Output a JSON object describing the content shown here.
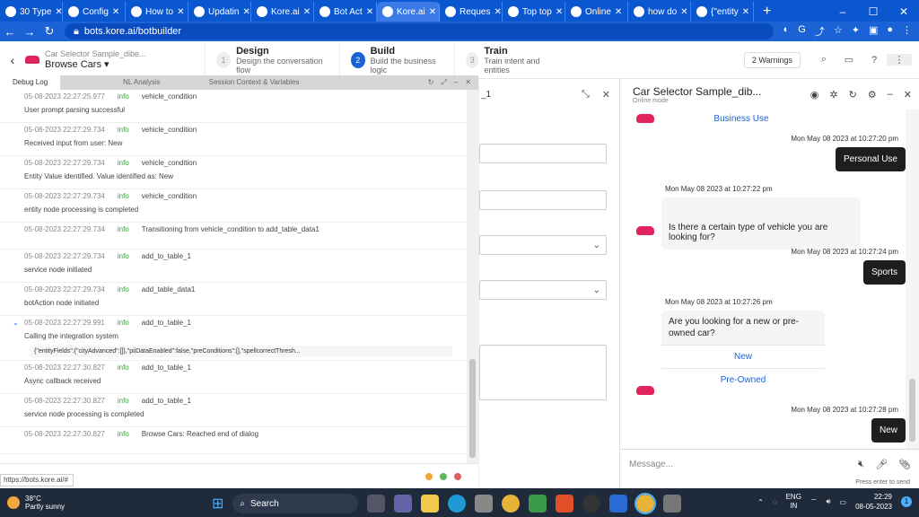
{
  "browser": {
    "tabs": [
      {
        "label": "30 Type"
      },
      {
        "label": "Config"
      },
      {
        "label": "How to"
      },
      {
        "label": "Updatin"
      },
      {
        "label": "Kore.ai"
      },
      {
        "label": "Bot Act"
      },
      {
        "label": "Kore.ai",
        "active": true
      },
      {
        "label": "Reques"
      },
      {
        "label": "Top top"
      },
      {
        "label": "Online"
      },
      {
        "label": "how do"
      },
      {
        "label": "{\"entity"
      }
    ],
    "new_tab": "+",
    "url": "bots.kore.ai/botbuilder"
  },
  "app_header": {
    "bot_subtitle": "Car Selector Sample_dibe...",
    "dialog_name": "Browse Cars",
    "steps": [
      {
        "num": "1",
        "title": "Design",
        "desc": "Design the conversation flow"
      },
      {
        "num": "2",
        "title": "Build",
        "desc": "Build the business logic",
        "active": true
      },
      {
        "num": "3",
        "title": "Train",
        "desc": "Train intent and entities"
      }
    ],
    "warnings": "2 Warnings"
  },
  "debug": {
    "tabs": [
      "Debug Log",
      "NL Analysis",
      "Session Context & Variables"
    ],
    "entries": [
      {
        "time": "05-08-2023 22:27:25.977",
        "level": "info",
        "component": "vehicle_condition",
        "message": "User prompt parsing successful"
      },
      {
        "time": "05-08-2023 22:27:29.734",
        "level": "info",
        "component": "vehicle_condition",
        "message": "Received input from user: New"
      },
      {
        "time": "05-08-2023 22:27:29.734",
        "level": "info",
        "component": "vehicle_condition",
        "message": "Entity Value identified. Value identified as: New"
      },
      {
        "time": "05-08-2023 22:27:29.734",
        "level": "info",
        "component": "vehicle_condition",
        "message": "entity node processing is completed"
      },
      {
        "time": "05-08-2023 22:27:29.734",
        "level": "info",
        "component": "Transitioning from vehicle_condition to add_table_data1",
        "message": ""
      },
      {
        "time": "05-08-2023 22:27:29.734",
        "level": "info",
        "component": "add_to_table_1",
        "message": "service node initiated"
      },
      {
        "time": "05-08-2023 22:27:29.734",
        "level": "info",
        "component": "add_table_data1",
        "message": "botAction node initiated"
      },
      {
        "time": "05-08-2023 22:27:29.991",
        "level": "info",
        "component": "add_to_table_1",
        "message": "Calling the integration system",
        "expanded": true,
        "json": "{\"entityFields\":{\"cityAdvanced\":[]},\"piiDataEnabled\":false,\"preConditions\":[],\"spellcorrectThresh..."
      },
      {
        "time": "05-08-2023 22:27:30.827",
        "level": "info",
        "component": "add_to_table_1",
        "message": "Async callback received"
      },
      {
        "time": "05-08-2023 22:27:30.827",
        "level": "info",
        "component": "add_to_table_1",
        "message": "service node processing is completed"
      },
      {
        "time": "05-08-2023 22:27:30.827",
        "level": "info",
        "component": "Browse Cars: Reached end of dialog",
        "message": ""
      }
    ]
  },
  "status_url": "https://bots.kore.ai/#",
  "mid_panel": {
    "title_fragment": "_1"
  },
  "chat": {
    "title": "Car Selector Sample_dib...",
    "mode": "Online mode",
    "items": [
      {
        "type": "bot_option_only",
        "option": "Business Use"
      },
      {
        "type": "time_right",
        "text": "Mon May 08 2023 at 10:27:20 pm"
      },
      {
        "type": "user",
        "text": "Personal Use"
      },
      {
        "type": "time_left",
        "text": "Mon May 08 2023 at 10:27:22 pm"
      },
      {
        "type": "bot",
        "text": "Is there a certain type of vehicle you are looking for?"
      },
      {
        "type": "time_right",
        "text": "Mon May 08 2023 at 10:27:24 pm"
      },
      {
        "type": "user",
        "text": "Sports"
      },
      {
        "type": "time_left",
        "text": "Mon May 08 2023 at 10:27:26 pm"
      },
      {
        "type": "bot_options",
        "text": "Are you looking for a new or pre-owned car?",
        "options": [
          "New",
          "Pre-Owned"
        ]
      },
      {
        "type": "time_right",
        "text": "Mon May 08 2023 at 10:27:28 pm"
      },
      {
        "type": "user",
        "text": "New"
      }
    ],
    "input_placeholder": "Message...",
    "press_enter": "Press enter to send"
  },
  "taskbar": {
    "temp": "38°C",
    "weather": "Partly sunny",
    "search": "Search",
    "lang1": "ENG",
    "lang2": "IN",
    "time": "22:29",
    "date": "08-05-2023",
    "badge": "1"
  },
  "colors": {
    "primary": "#1a62d6",
    "info": "#3c9a3c",
    "car": "#e0245e"
  }
}
